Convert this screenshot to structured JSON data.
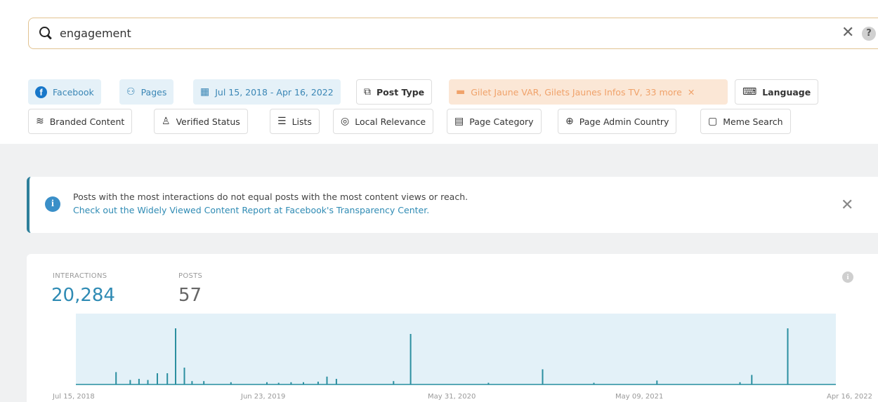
{
  "search": {
    "query": "engagement"
  },
  "filters": {
    "row1": [
      {
        "label": "Facebook",
        "icon": "facebook-icon",
        "style": "selected"
      },
      {
        "label": "Pages",
        "icon": "pages-icon",
        "style": "selected"
      },
      {
        "label": "Jul 15, 2018 - Apr 16, 2022",
        "icon": "calendar-icon",
        "style": "selected"
      },
      {
        "label": "Post Type",
        "icon": "post-type-icon",
        "style": "outline"
      },
      {
        "label": "Gilet Jaune VAR, Gilets Jaunes Infos TV, 33 more",
        "icon": "list-icon",
        "style": "warning"
      },
      {
        "label": "Language",
        "icon": "language-icon",
        "style": "outline"
      }
    ],
    "row2": [
      {
        "label": "Branded Content",
        "icon": "branded-content-icon"
      },
      {
        "label": "Verified Status",
        "icon": "verified-status-icon"
      },
      {
        "label": "Lists",
        "icon": "lists-icon"
      },
      {
        "label": "Local Relevance",
        "icon": "location-icon"
      },
      {
        "label": "Page Category",
        "icon": "page-category-icon"
      },
      {
        "label": "Page Admin Country",
        "icon": "globe-icon"
      },
      {
        "label": "Meme Search",
        "icon": "meme-search-icon"
      }
    ]
  },
  "notice": {
    "line1": "Posts with the most interactions do not equal posts with the most content views or reach.",
    "line2": "Check out the Widely Viewed Content Report at Facebook's Transparency Center."
  },
  "stats": {
    "interactions_label": "INTERACTIONS",
    "interactions_value": "20,284",
    "posts_label": "POSTS",
    "posts_value": "57"
  },
  "colors": {
    "accent": "#2f8bb4",
    "chart_fill": "#e3f1f8",
    "chart_line": "#2b8fa0",
    "warning_bg": "#fbe7d6"
  },
  "chart_data": {
    "type": "bar",
    "title": "",
    "xlabel": "",
    "ylabel": "",
    "x_range": [
      "2018-07-15",
      "2022-04-16"
    ],
    "x_tick_labels": [
      "Jul 15, 2018",
      "Jun 23, 2019",
      "May 31, 2020",
      "May 09, 2021",
      "Apr 16, 2022"
    ],
    "series": [
      {
        "values": [
          {
            "date": "2018-10-27",
            "value": 0.22
          },
          {
            "date": "2018-11-20",
            "value": 0.08
          },
          {
            "date": "2018-12-05",
            "value": 0.1
          },
          {
            "date": "2018-12-20",
            "value": 0.08
          },
          {
            "date": "2019-01-05",
            "value": 0.2
          },
          {
            "date": "2019-01-22",
            "value": 0.2
          },
          {
            "date": "2019-02-05",
            "value": 1.0
          },
          {
            "date": "2019-02-20",
            "value": 0.3
          },
          {
            "date": "2019-03-05",
            "value": 0.06
          },
          {
            "date": "2019-03-25",
            "value": 0.06
          },
          {
            "date": "2019-05-10",
            "value": 0.04
          },
          {
            "date": "2019-07-10",
            "value": 0.04
          },
          {
            "date": "2019-07-30",
            "value": 0.03
          },
          {
            "date": "2019-08-20",
            "value": 0.04
          },
          {
            "date": "2019-09-10",
            "value": 0.04
          },
          {
            "date": "2019-10-05",
            "value": 0.05
          },
          {
            "date": "2019-10-20",
            "value": 0.14
          },
          {
            "date": "2019-11-05",
            "value": 0.1
          },
          {
            "date": "2020-02-10",
            "value": 0.06
          },
          {
            "date": "2020-03-10",
            "value": 0.9
          },
          {
            "date": "2020-07-20",
            "value": 0.03
          },
          {
            "date": "2020-10-20",
            "value": 0.27
          },
          {
            "date": "2021-01-15",
            "value": 0.03
          },
          {
            "date": "2021-05-02",
            "value": 0.07
          },
          {
            "date": "2021-09-20",
            "value": 0.04
          },
          {
            "date": "2021-10-10",
            "value": 0.17
          },
          {
            "date": "2021-12-10",
            "value": 1.0
          }
        ]
      }
    ],
    "grid": false
  }
}
